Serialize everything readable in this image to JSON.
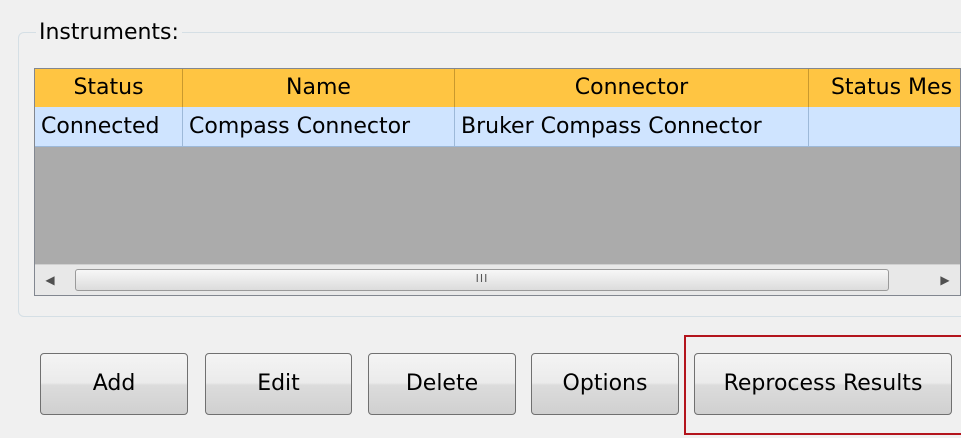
{
  "instruments_group": {
    "label": "Instruments:"
  },
  "grid": {
    "columns": [
      "Status",
      "Name",
      "Connector",
      "Status Mes"
    ],
    "rows": [
      [
        "Connected",
        "Compass Connector",
        "Bruker Compass Connector",
        ""
      ]
    ],
    "row_selected_color": "#cfe4ff",
    "header_color": "#ffc542",
    "empty_area_color": "#ababab"
  },
  "scrollbar": {
    "thumb_grip": "III",
    "left_icon": "arrow-left-icon",
    "right_icon": "arrow-right-icon"
  },
  "buttons": {
    "add": "Add",
    "edit": "Edit",
    "delete": "Delete",
    "options": "Options",
    "reprocess": "Reprocess Results"
  },
  "highlight": {
    "target": "reprocess-results-button",
    "color": "#b3141c"
  }
}
